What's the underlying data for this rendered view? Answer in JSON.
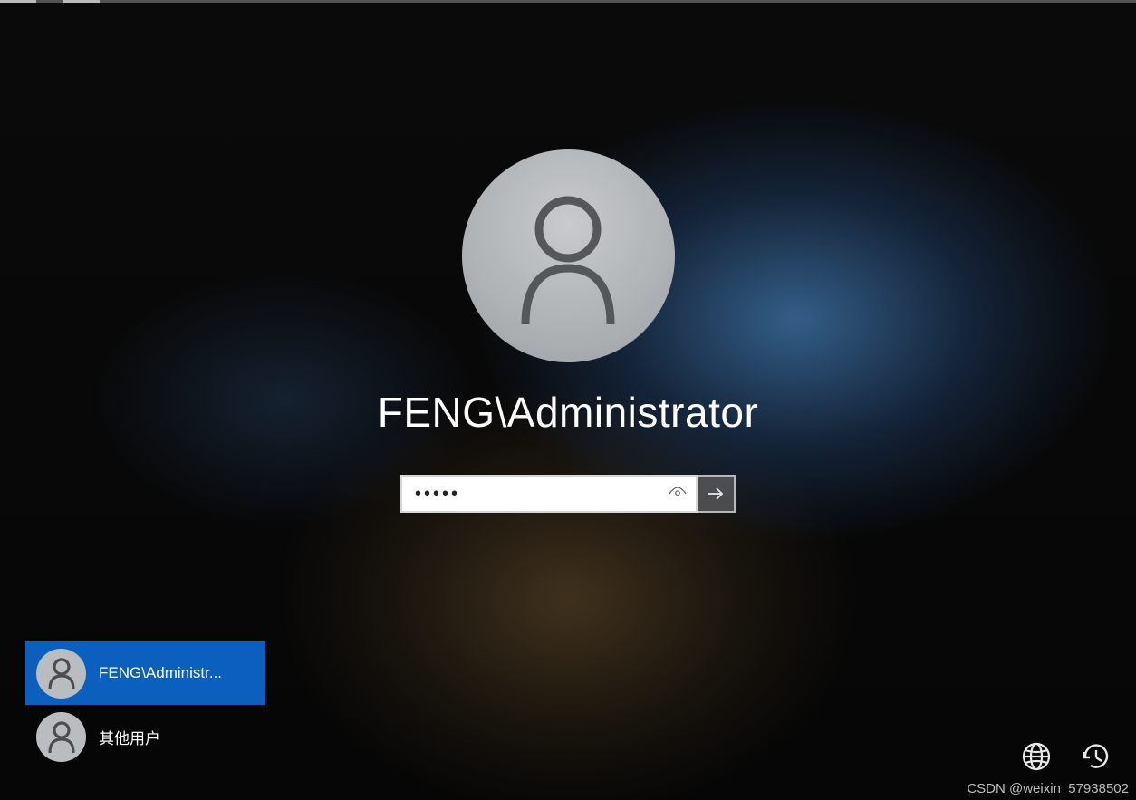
{
  "login": {
    "username_display": "FENG\\Administrator",
    "password_value": "•••••",
    "password_placeholder": ""
  },
  "accounts": [
    {
      "label": "FENG\\Administr...",
      "selected": true
    },
    {
      "label": "其他用户",
      "selected": false
    }
  ],
  "utilities": {
    "network_icon": "network-icon",
    "ease_icon": "ease-of-access-icon"
  },
  "watermark": "CSDN @weixin_57938502"
}
